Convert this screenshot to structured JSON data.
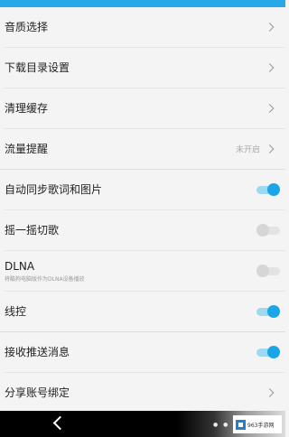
{
  "settings": {
    "items": [
      {
        "label": "音质选择",
        "type": "nav"
      },
      {
        "label": "下载目录设置",
        "type": "nav"
      },
      {
        "label": "清理缓存",
        "type": "nav"
      },
      {
        "label": "流量提醒",
        "type": "nav",
        "value": "未开启"
      },
      {
        "label": "自动同步歌词和图片",
        "type": "toggle",
        "on": true
      },
      {
        "label": "摇一摇切歌",
        "type": "toggle",
        "on": false
      },
      {
        "label": "DLNA",
        "sublabel": "将酷狗电脑版作为DLNA设备播放",
        "type": "toggle",
        "on": false
      },
      {
        "label": "线控",
        "type": "toggle",
        "on": true
      },
      {
        "label": "接收推送消息",
        "type": "toggle",
        "on": true
      },
      {
        "label": "分享账号绑定",
        "type": "nav"
      }
    ]
  },
  "watermark": {
    "text": "963手游网"
  },
  "colors": {
    "accent": "#1aa6e6",
    "topbar": "#29a8e8"
  }
}
